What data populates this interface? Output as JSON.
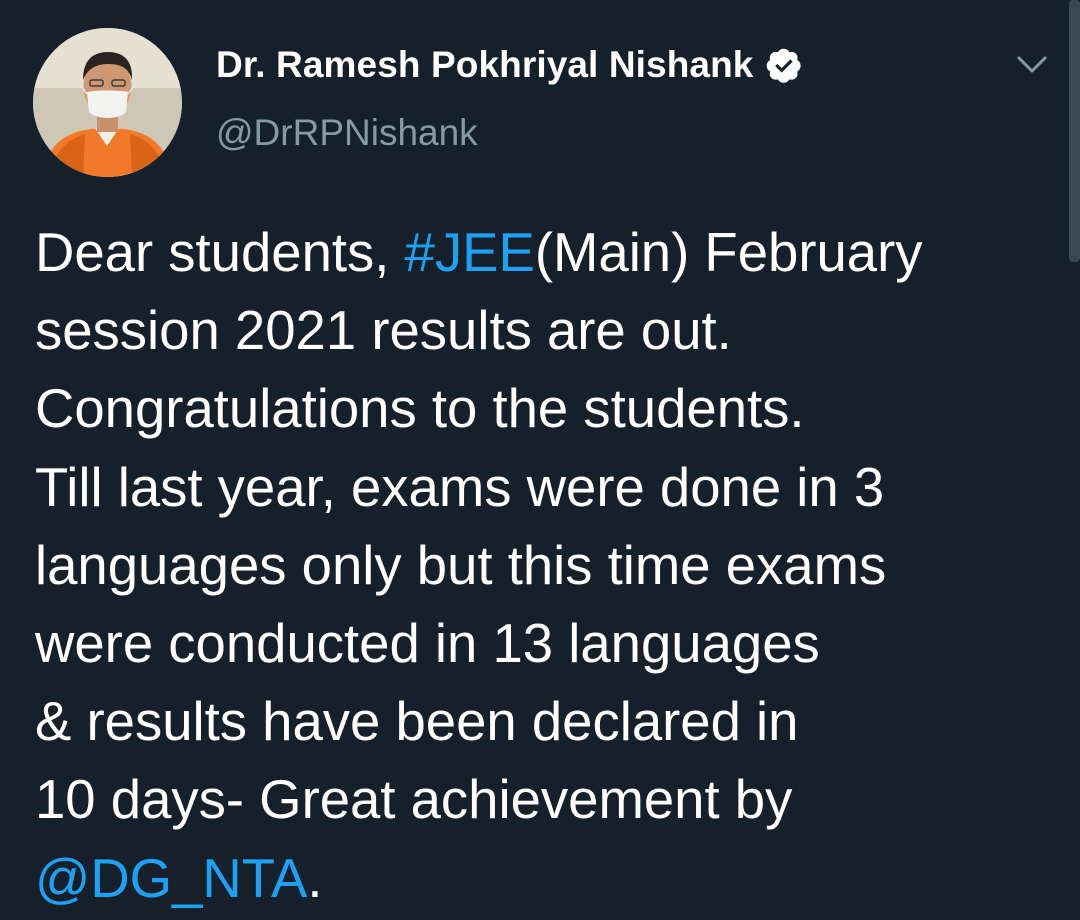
{
  "author": {
    "display_name": "Dr. Ramesh Pokhriyal Nishank",
    "handle": "@DrRPNishank"
  },
  "icons": {
    "verified": "verified-badge-icon",
    "menu": "chevron-down-icon"
  },
  "colors": {
    "background": "#15202b",
    "text": "#ffffff",
    "handle": "#8899a6",
    "link": "#1da1f2"
  },
  "tweet": {
    "lines": [
      {
        "text_before": "Dear students, ",
        "hashtag": "#JEE",
        "text_after": "(Main) February"
      },
      {
        "text": "session 2021 results are out."
      },
      {
        "text": "Congratulations to the students."
      },
      {
        "text": "Till last year, exams were done in 3"
      },
      {
        "text": "languages only but this time exams"
      },
      {
        "text": "were conducted in 13 languages"
      },
      {
        "text": "& results have been declared in"
      },
      {
        "text": "10 days- Great achievement by"
      },
      {
        "mention": "@DG_NTA",
        "text_after": "."
      }
    ]
  }
}
